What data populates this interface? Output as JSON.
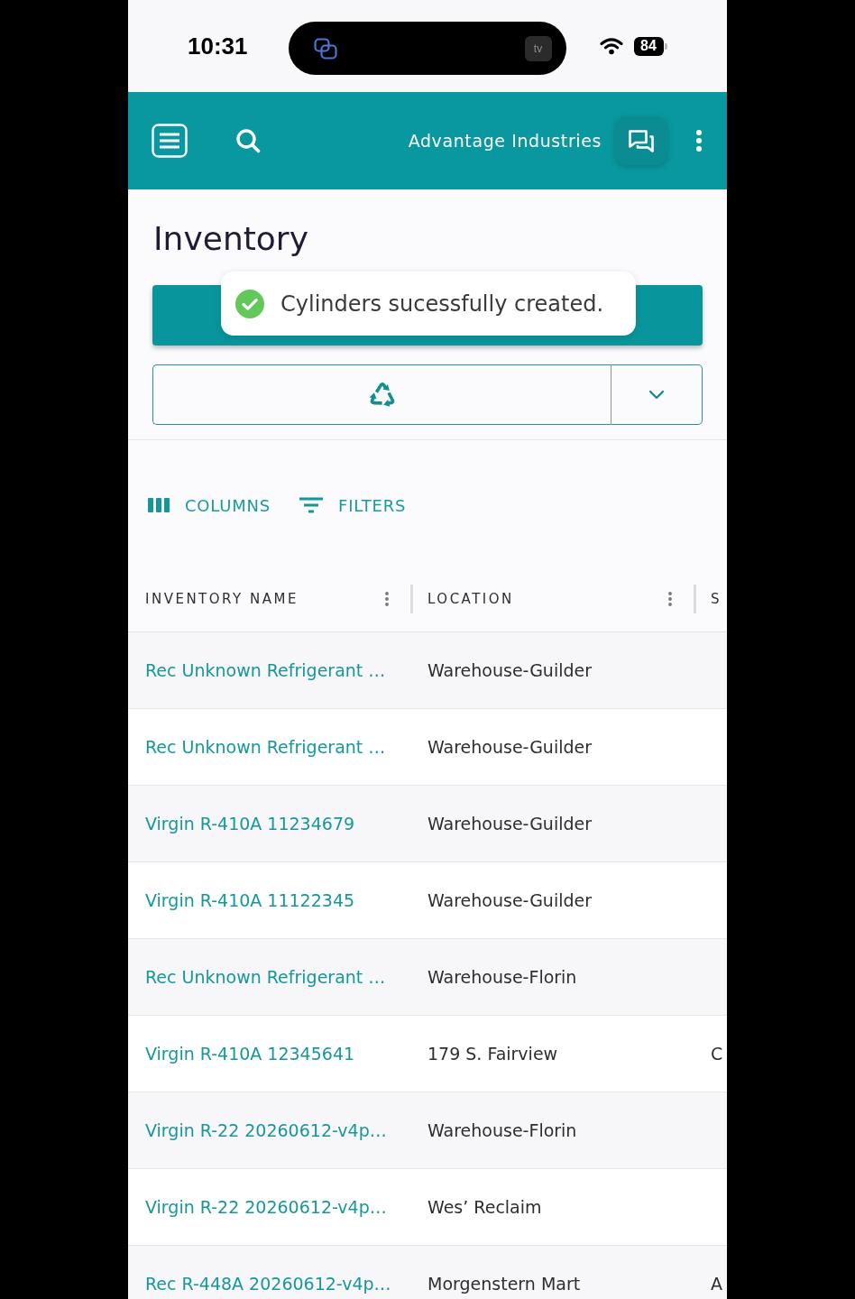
{
  "status_bar": {
    "time": "10:31",
    "island_badge": "tv",
    "battery": "84"
  },
  "app_bar": {
    "title": "Advantage Industries"
  },
  "page": {
    "title": "Inventory"
  },
  "toast": {
    "message": "Cylinders sucessfully created."
  },
  "toolbar": [
    {
      "kind": "columns",
      "label": "COLUMNS"
    },
    {
      "kind": "filters",
      "label": "FILTERS"
    }
  ],
  "table": {
    "columns": [
      {
        "label": "INVENTORY NAME",
        "menu": true
      },
      {
        "label": "LOCATION",
        "menu": true
      },
      {
        "label": "S",
        "menu": false
      }
    ],
    "rows": [
      {
        "name": "Rec Unknown Refrigerant …",
        "location": "Warehouse-Guilder"
      },
      {
        "name": "Rec Unknown Refrigerant …",
        "location": "Warehouse-Guilder"
      },
      {
        "name": "Virgin R-410A 11234679",
        "location": "Warehouse-Guilder"
      },
      {
        "name": "Virgin R-410A 11122345",
        "location": "Warehouse-Guilder"
      },
      {
        "name": "Rec Unknown Refrigerant …",
        "location": "Warehouse-Florin"
      },
      {
        "name": "Virgin R-410A 12345641",
        "location": "179 S. Fairview",
        "column_3": "C"
      },
      {
        "name": "Virgin R-22 20260612-v4p…",
        "location": "Warehouse-Florin"
      },
      {
        "name": "Virgin R-22 20260612-v4p…",
        "location": "Wes’ Reclaim"
      },
      {
        "name": "Rec R-448A 20260612-v4p…",
        "location": "Morgenstern Mart",
        "column_3": "A"
      }
    ]
  }
}
